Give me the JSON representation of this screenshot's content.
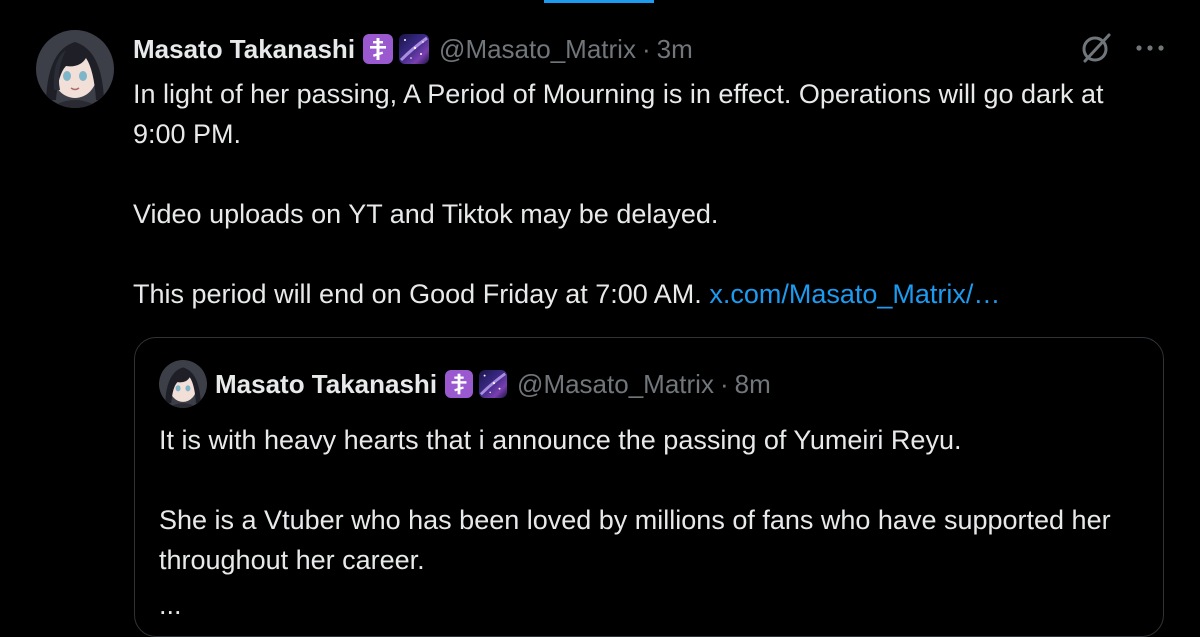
{
  "tweet": {
    "author": {
      "display_name": "Masato Takanashi",
      "handle": "@Masato_Matrix",
      "time": "3m",
      "separator": "·",
      "badges": [
        "orthodox-cross-emoji",
        "milky-way-emoji"
      ]
    },
    "text": {
      "line1": "In light of her passing, A Period of Mourning is in effect. Operations will go dark at 9:00 PM.",
      "line2": "Video uploads on YT and Tiktok may be delayed.",
      "line3": "This period will end on Good Friday at 7:00 AM.",
      "link": "x.com/Masato_Matrix/…"
    },
    "actions": {
      "grok_icon": "grok-icon",
      "more_icon": "more-horizontal-icon"
    }
  },
  "quoted_tweet": {
    "author": {
      "display_name": "Masato Takanashi",
      "handle": "@Masato_Matrix",
      "time": "8m",
      "separator": "·"
    },
    "text": {
      "line1": "It is with heavy hearts that i announce the passing of Yumeiri Reyu.",
      "line2": "She is a Vtuber who has been loved by millions of fans who have supported her throughout her career.",
      "truncated": "..."
    }
  },
  "colors": {
    "background": "#000000",
    "text_primary": "#e7e9ea",
    "text_secondary": "#71767b",
    "link": "#1d9bf0",
    "border": "#2f3336",
    "badge_purple": "#9b59d0"
  }
}
